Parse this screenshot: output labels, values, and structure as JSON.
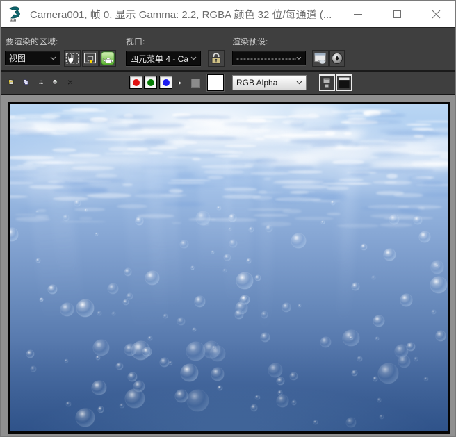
{
  "window": {
    "title": "Camera001, 帧 0, 显示 Gamma: 2.2, RGBA 颜色 32 位/每通道 (..."
  },
  "toolbar": {
    "area_label": "要渲染的区域:",
    "area_value": "视图",
    "viewport_label": "视口:",
    "viewport_value": "四元菜单 4 - Ca",
    "preset_label": "渲染预设:",
    "preset_value": "--------------------",
    "channel_value": "RGB Alpha"
  },
  "icons": {
    "app": "3dsmax-logo",
    "row1": [
      "pan-region-icon",
      "edit-region-icon",
      "render-teapot-icon",
      "lock-icon",
      "render-setup-icon",
      "environment-icon"
    ],
    "row2": [
      "save-icon",
      "copy-icon",
      "clone-icon",
      "print-icon",
      "delete-icon",
      "red-channel",
      "green-channel",
      "blue-channel",
      "monochrome-icon",
      "alpha-channel-icon",
      "background-swatch",
      "overlay-toggle-icon",
      "ui-toggle-icon"
    ]
  },
  "render_image": {
    "description": "underwater scene seen from below: bright rippled water surface with white caustics at top, god rays, blue gradient deepening downward, rising air bubbles",
    "seed": 7,
    "colors": {
      "surface_light": "#bad7f4",
      "mid_blue": "#7596c6",
      "deep_blue": "#375c95",
      "caustic": "#ffffff",
      "mottle": "#6f9ad8",
      "ray": "#e2eeff"
    },
    "caustics": {
      "count": 170,
      "patch_count": 20
    },
    "mottling": {
      "count": 70
    },
    "god_rays": {
      "count": 9
    },
    "bubbles": {
      "count": 118,
      "min_r": 2,
      "max_r": 11
    },
    "channel_red": "#e01212",
    "channel_green": "#067d06",
    "channel_blue": "#1c1cf0"
  }
}
